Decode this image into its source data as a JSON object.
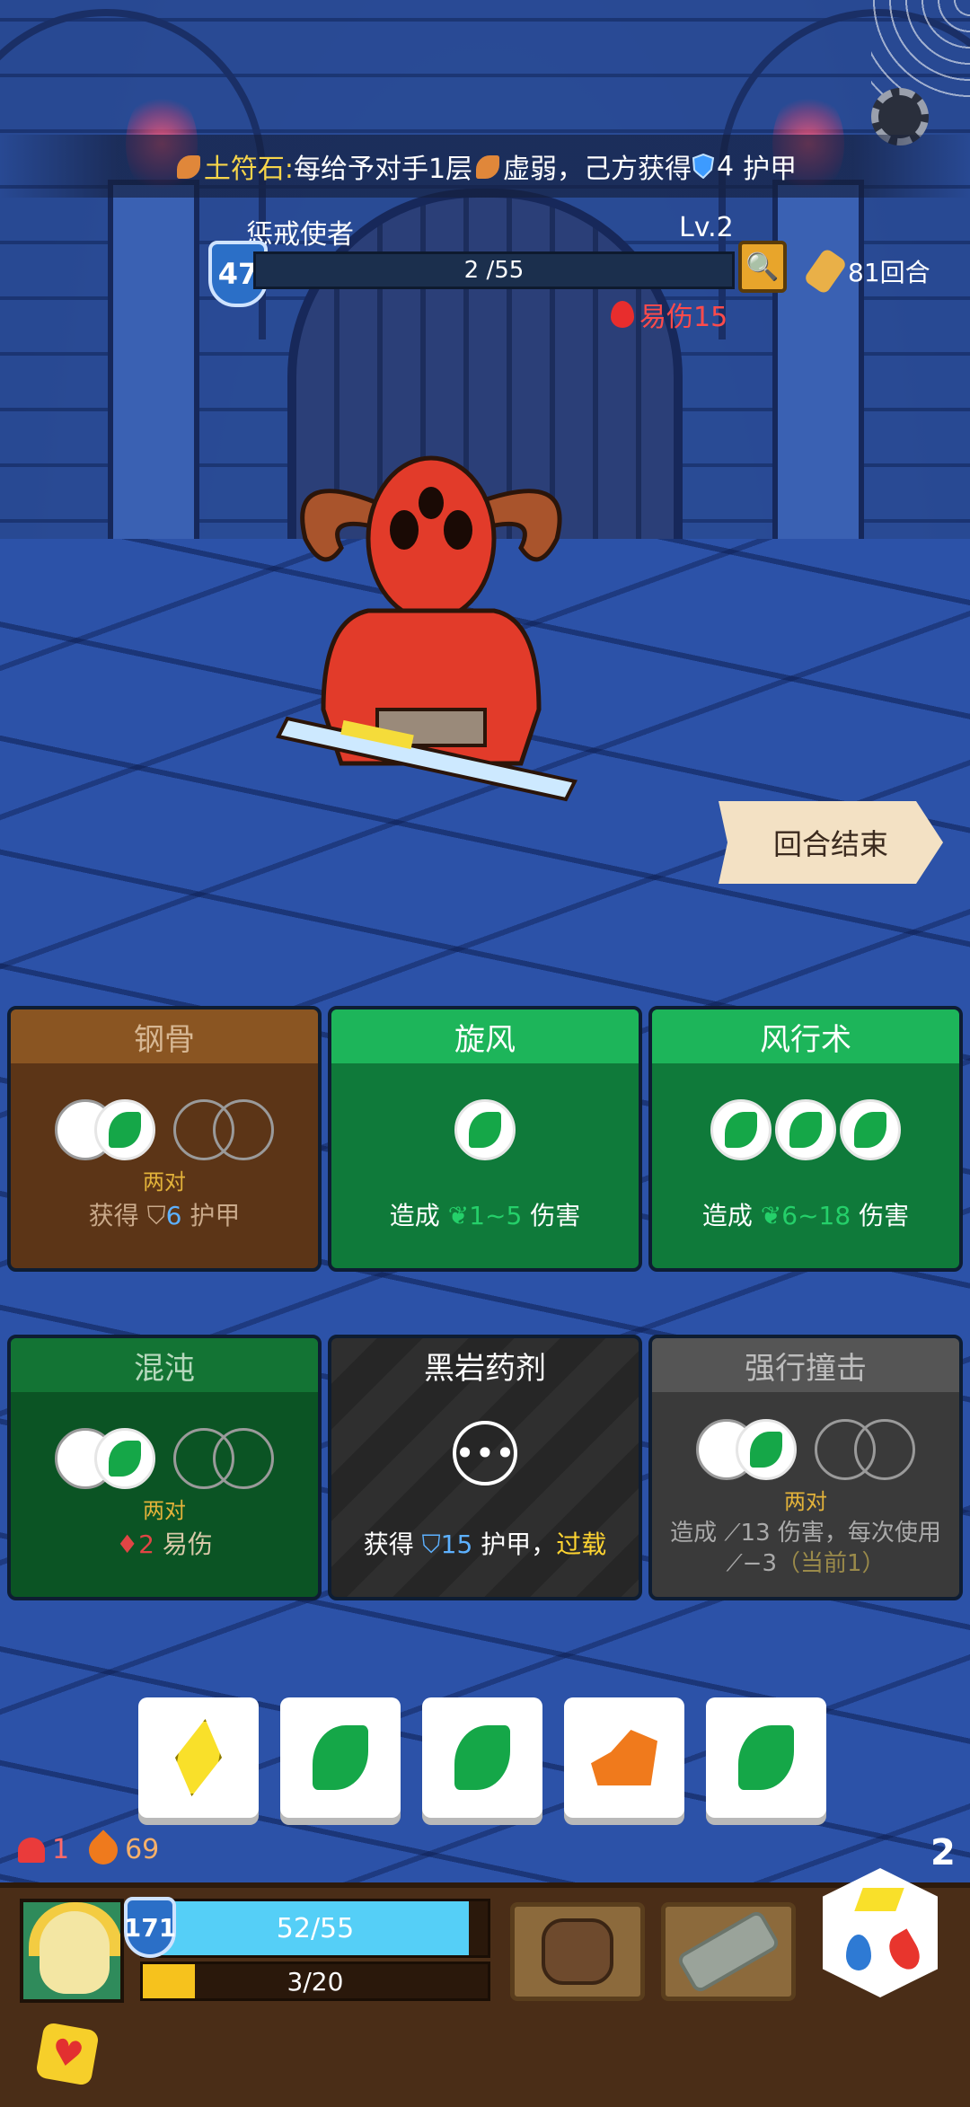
{
  "banner": {
    "title": "土符石:",
    "text_a": "每给予对手1层",
    "text_b": "虚弱，己方获得",
    "shield_value": "4",
    "text_c": "护甲"
  },
  "enemy": {
    "name": "惩戒使者",
    "level": "Lv.2",
    "shield": "47",
    "hp_text": "2 /55",
    "hp_current": 2,
    "hp_max": 55,
    "debuff_label": "易伤15"
  },
  "round": {
    "label": "81回合"
  },
  "end_turn": {
    "label": "回合结束"
  },
  "cards": [
    {
      "title": "钢骨",
      "pair_label": "两对",
      "desc_a": "获得",
      "desc_num": "6",
      "desc_b": "护甲"
    },
    {
      "title": "旋风",
      "desc_a": "造成",
      "desc_num": "1~5",
      "desc_b": "伤害"
    },
    {
      "title": "风行术",
      "desc_a": "造成",
      "desc_num": "6~18",
      "desc_b": "伤害"
    },
    {
      "title": "混沌",
      "pair_label": "两对",
      "desc_num": "2",
      "desc_b": "易伤"
    },
    {
      "title": "黑岩药剂",
      "desc_a": "获得",
      "desc_num": "15",
      "desc_b": "护甲，",
      "desc_hl": "过载",
      "dots": "•••"
    },
    {
      "title": "强行撞击",
      "pair_label": "两对",
      "desc_line1": "造成 ⟋13 伤害，每次使用",
      "desc_line2": "⟋−3",
      "desc_dim": "（当前1）"
    }
  ],
  "dice": [
    {
      "face": "yellow-diamond"
    },
    {
      "face": "green-leaf"
    },
    {
      "face": "green-leaf"
    },
    {
      "face": "orange-rock"
    },
    {
      "face": "green-leaf"
    }
  ],
  "player": {
    "heart_stat": "1",
    "fire_stat": "69",
    "shield": "171",
    "hp_text": "52/55",
    "hp_fraction": 0.945,
    "xp_text": "3/20",
    "xp_fraction": 0.15,
    "dice_count": "2"
  },
  "colors": {
    "banner_title": "#f7d54a",
    "debuff": "#ff4b4b",
    "hp_bar": "#55cff7",
    "xp_bar": "#f6c21d",
    "overload": "#ffd531"
  }
}
